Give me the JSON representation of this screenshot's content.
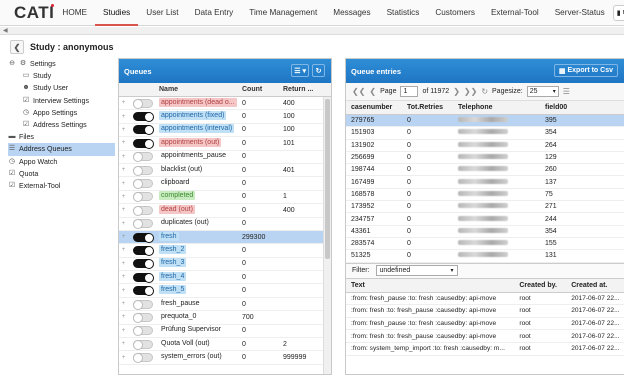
{
  "nav": {
    "logo": "CATI",
    "items": [
      "HOME",
      "Studies",
      "User List",
      "Data Entry",
      "Time Management",
      "Messages",
      "Statistics",
      "Customers",
      "External-Tool",
      "Server-Status"
    ],
    "active": "Studies",
    "user_label": "ro"
  },
  "breadcrumb": {
    "title": "Study : anonymous"
  },
  "sidebar": {
    "items": [
      {
        "label": "Settings",
        "level": 0,
        "icon": "gear-icon"
      },
      {
        "label": "Study",
        "level": 1,
        "icon": "document-icon"
      },
      {
        "label": "Study User",
        "level": 1,
        "icon": "user-icon"
      },
      {
        "label": "Interview Settings",
        "level": 1,
        "icon": "checkbox-icon"
      },
      {
        "label": "Appo Settings",
        "level": 1,
        "icon": "clock-icon"
      },
      {
        "label": "Address Settings",
        "level": 1,
        "icon": "checkbox-icon"
      },
      {
        "label": "Files",
        "level": 0,
        "icon": "folder-icon"
      },
      {
        "label": "Address Queues",
        "level": 0,
        "icon": "list-icon"
      },
      {
        "label": "Appo Watch",
        "level": 0,
        "icon": "clock-icon"
      },
      {
        "label": "Quota",
        "level": 0,
        "icon": "checkbox-icon"
      },
      {
        "label": "External-Tool",
        "level": 0,
        "icon": "checkbox-icon"
      }
    ],
    "active": "Address Queues"
  },
  "queues": {
    "title": "Queues",
    "columns": [
      "Name",
      "Count",
      "Return ..."
    ],
    "rows": [
      {
        "name": "appointments (dead o...",
        "count": "0",
        "ret": "400",
        "on": false,
        "tag": "#f5c6c6",
        "text": "#b04040"
      },
      {
        "name": "appointments (fixed)",
        "count": "0",
        "ret": "100",
        "on": true,
        "tag": "#bfe0f5",
        "text": "#1f66a8"
      },
      {
        "name": "appointments (interval)",
        "count": "0",
        "ret": "100",
        "on": true,
        "tag": "#bfe0f5",
        "text": "#1f66a8"
      },
      {
        "name": "appointments (out)",
        "count": "0",
        "ret": "101",
        "on": true,
        "tag": "#f5c6c6",
        "text": "#b04040"
      },
      {
        "name": "appointments_pause",
        "count": "0",
        "ret": "",
        "on": false,
        "tag": "",
        "text": "#222222"
      },
      {
        "name": "blacklist (out)",
        "count": "0",
        "ret": "401",
        "on": false,
        "tag": "",
        "text": "#222222"
      },
      {
        "name": "clipboard",
        "count": "0",
        "ret": "",
        "on": false,
        "tag": "",
        "text": "#222222"
      },
      {
        "name": "completed",
        "count": "0",
        "ret": "1",
        "on": false,
        "tag": "#c8ecc0",
        "text": "#3c8a2e"
      },
      {
        "name": "dead (out)",
        "count": "0",
        "ret": "400",
        "on": false,
        "tag": "#f5c6c6",
        "text": "#b04040"
      },
      {
        "name": "duplicates (out)",
        "count": "0",
        "ret": "",
        "on": false,
        "tag": "",
        "text": "#222222"
      },
      {
        "name": "fresh",
        "count": "299300",
        "ret": "",
        "on": true,
        "tag": "#bfe0f5",
        "text": "#1f66a8",
        "selected": true
      },
      {
        "name": "fresh_2",
        "count": "0",
        "ret": "",
        "on": true,
        "tag": "#bfe0f5",
        "text": "#1f66a8"
      },
      {
        "name": "fresh_3",
        "count": "0",
        "ret": "",
        "on": true,
        "tag": "#bfe0f5",
        "text": "#1f66a8"
      },
      {
        "name": "fresh_4",
        "count": "0",
        "ret": "",
        "on": true,
        "tag": "#bfe0f5",
        "text": "#1f66a8"
      },
      {
        "name": "fresh_5",
        "count": "0",
        "ret": "",
        "on": true,
        "tag": "#bfe0f5",
        "text": "#1f66a8"
      },
      {
        "name": "fresh_pause",
        "count": "0",
        "ret": "",
        "on": false,
        "tag": "",
        "text": "#222222"
      },
      {
        "name": "prequota_0",
        "count": "700",
        "ret": "",
        "on": false,
        "tag": "",
        "text": "#222222"
      },
      {
        "name": "Prüfung Supervisor",
        "count": "0",
        "ret": "",
        "on": false,
        "tag": "",
        "text": "#222222"
      },
      {
        "name": "Quota Voll (out)",
        "count": "0",
        "ret": "2",
        "on": false,
        "tag": "",
        "text": "#222222"
      },
      {
        "name": "system_errors (out)",
        "count": "0",
        "ret": "999999",
        "on": false,
        "tag": "",
        "text": "#222222"
      }
    ]
  },
  "entries": {
    "title": "Queue entries",
    "export_label": "Export to Csv",
    "pager": {
      "page_label": "Page",
      "page": "1",
      "of_label": "of 11972",
      "pagesize_label": "Pagesize:",
      "pagesize": "25"
    },
    "columns": [
      "casenumber",
      "Tot.Retries",
      "Telephone",
      "field00"
    ],
    "rows": [
      {
        "case": "279765",
        "retries": "0",
        "field": "395",
        "selected": true
      },
      {
        "case": "151903",
        "retries": "0",
        "field": "354"
      },
      {
        "case": "131902",
        "retries": "0",
        "field": "264"
      },
      {
        "case": "256699",
        "retries": "0",
        "field": "129"
      },
      {
        "case": "198744",
        "retries": "0",
        "field": "260"
      },
      {
        "case": "167499",
        "retries": "0",
        "field": "137"
      },
      {
        "case": "168578",
        "retries": "0",
        "field": "75"
      },
      {
        "case": "173952",
        "retries": "0",
        "field": "271"
      },
      {
        "case": "234757",
        "retries": "0",
        "field": "244"
      },
      {
        "case": "43361",
        "retries": "0",
        "field": "354"
      },
      {
        "case": "283574",
        "retries": "0",
        "field": "155"
      },
      {
        "case": "51325",
        "retries": "0",
        "field": "131"
      }
    ]
  },
  "filter": {
    "label": "Filter:",
    "value": "undefined"
  },
  "log": {
    "columns": [
      "Text",
      "Created by.",
      "Created at."
    ],
    "rows": [
      {
        "text": ":from: fresh_pause :to: fresh :causedby: api-move",
        "by": "root",
        "at": "2017-06-07 22..."
      },
      {
        "text": ":from: fresh :to: fresh_pause :causedby: api-move",
        "by": "root",
        "at": "2017-06-07 22..."
      },
      {
        "text": ":from: fresh_pause :to: fresh :causedby: api-move",
        "by": "root",
        "at": "2017-06-07 22..."
      },
      {
        "text": ":from: fresh :to: fresh_pause :causedby: api-move",
        "by": "root",
        "at": "2017-06-07 22..."
      },
      {
        "text": ":from: system_temp_import :to: fresh :causedby: m...",
        "by": "root",
        "at": "2017-06-07 22..."
      }
    ]
  }
}
